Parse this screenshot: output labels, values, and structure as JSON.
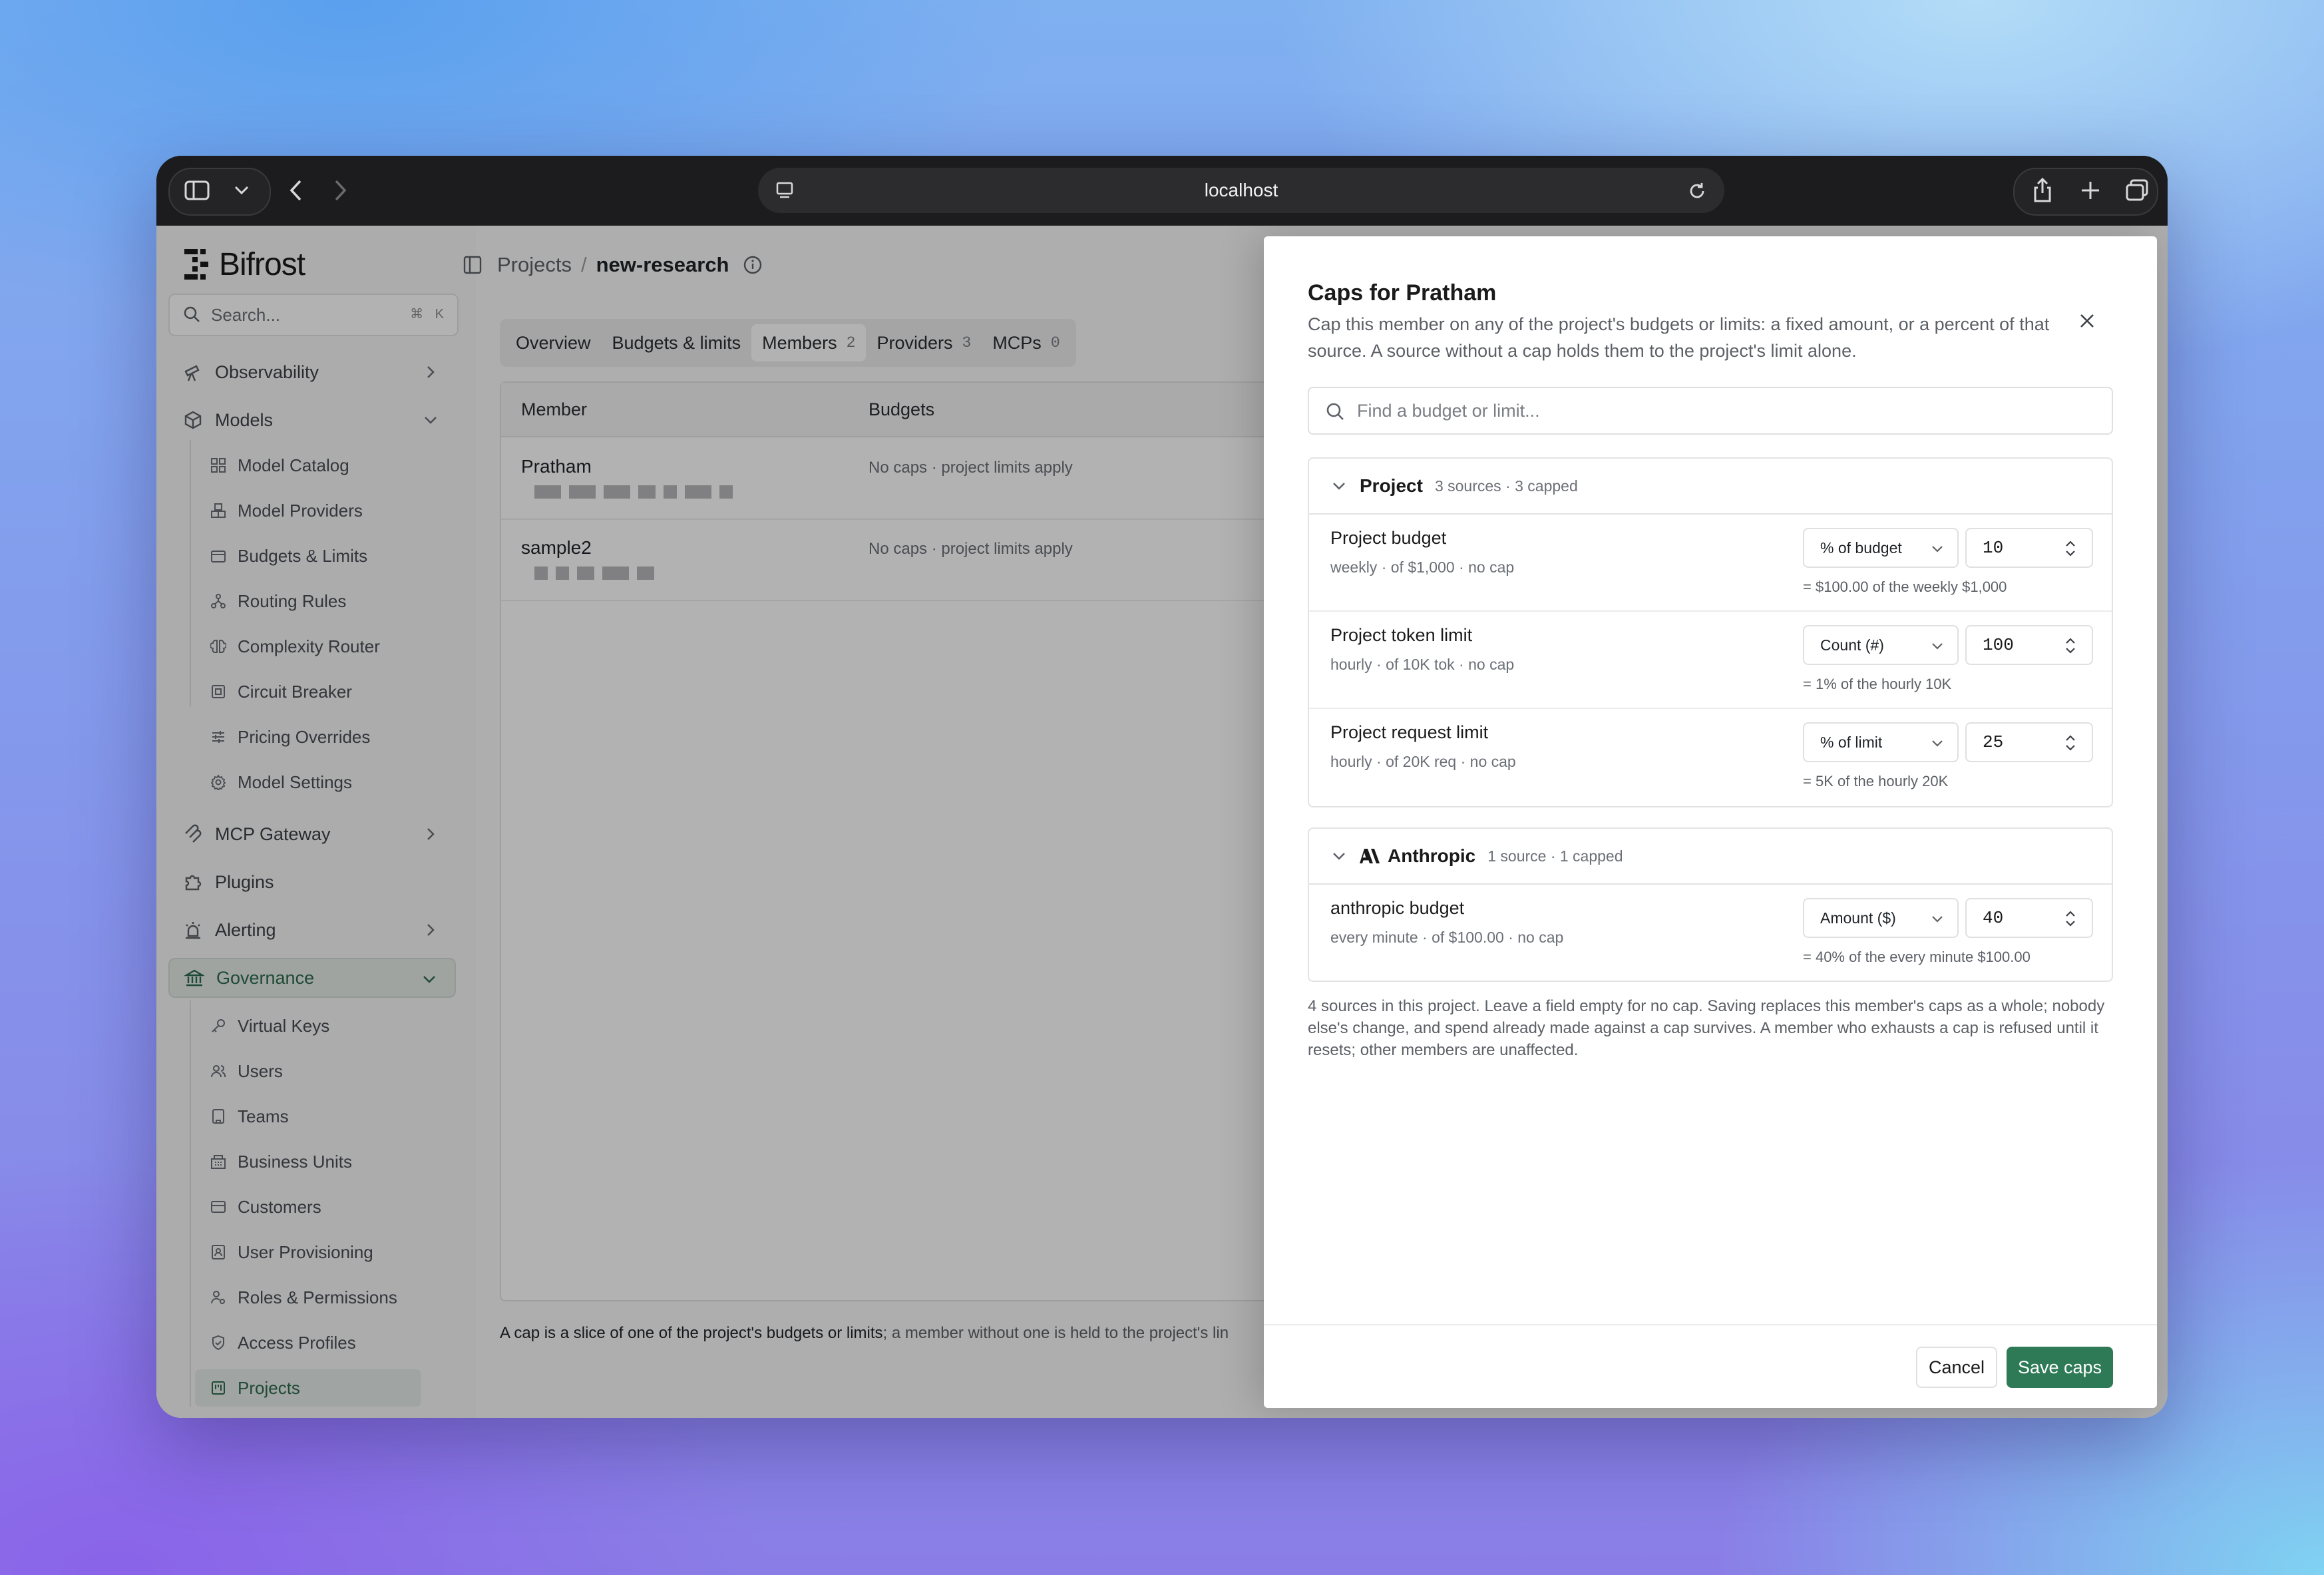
{
  "browser": {
    "url": "localhost"
  },
  "sidebar": {
    "logo": "Bifrost",
    "search_placeholder": "Search...",
    "search_shortcut": "⌘ K",
    "items": {
      "observability": "Observability",
      "models": "Models",
      "mcp_gateway": "MCP Gateway",
      "plugins": "Plugins",
      "alerting": "Alerting",
      "governance": "Governance"
    },
    "models_sub": [
      "Model Catalog",
      "Model Providers",
      "Budgets & Limits",
      "Routing Rules",
      "Complexity Router",
      "Circuit Breaker",
      "Pricing Overrides",
      "Model Settings"
    ],
    "governance_sub": [
      "Virtual Keys",
      "Users",
      "Teams",
      "Business Units",
      "Customers",
      "User Provisioning",
      "Roles & Permissions",
      "Access Profiles",
      "Projects"
    ]
  },
  "breadcrumb": {
    "parent": "Projects",
    "sep": "/",
    "current": "new-research"
  },
  "tabs": [
    {
      "label": "Overview",
      "count": ""
    },
    {
      "label": "Budgets & limits",
      "count": ""
    },
    {
      "label": "Members",
      "count": "2"
    },
    {
      "label": "Providers",
      "count": "3"
    },
    {
      "label": "MCPs",
      "count": "0"
    }
  ],
  "members_table": {
    "headers": {
      "member": "Member",
      "budgets": "Budgets"
    },
    "rows": [
      {
        "name": "Pratham",
        "budgets": "No caps · project limits apply"
      },
      {
        "name": "sample2",
        "budgets": "No caps · project limits apply"
      }
    ]
  },
  "footnote": {
    "bold": "A cap is a slice of one of the project's budgets or limits",
    "rest": "; a member without one is held to the project's lin"
  },
  "modal": {
    "title": "Caps for Pratham",
    "description": "Cap this member on any of the project's budgets or limits: a fixed amount, or a percent of that source. A source without a cap holds them to the project's limit alone.",
    "search_placeholder": "Find a budget or limit...",
    "groups": [
      {
        "name": "Project",
        "meta": "3 sources · 3 capped",
        "sources": [
          {
            "name": "Project budget",
            "sub": "weekly · of $1,000 · no cap",
            "mode": "% of budget",
            "value": "10",
            "hint": "= $100.00 of the weekly $1,000"
          },
          {
            "name": "Project token limit",
            "sub": "hourly · of 10K tok · no cap",
            "mode": "Count (#)",
            "value": "100",
            "hint": "= 1% of the hourly 10K"
          },
          {
            "name": "Project request limit",
            "sub": "hourly · of 20K req · no cap",
            "mode": "% of limit",
            "value": "25",
            "hint": "= 5K of the hourly 20K"
          }
        ]
      },
      {
        "name": "Anthropic",
        "meta": "1 source · 1 capped",
        "sources": [
          {
            "name": "anthropic budget",
            "sub": "every minute · of $100.00 · no cap",
            "mode": "Amount ($)",
            "value": "40",
            "hint": "= 40% of the every minute $100.00"
          }
        ]
      }
    ],
    "note": "4 sources in this project. Leave a field empty for no cap. Saving replaces this member's caps as a whole; nobody else's change, and spend already made against a cap survives. A member who exhausts a cap is refused until it resets; other members are unaffected.",
    "cancel_label": "Cancel",
    "save_label": "Save caps"
  },
  "colors": {
    "accent": "#2f7a56",
    "accent_text": "#2d6a4f"
  }
}
